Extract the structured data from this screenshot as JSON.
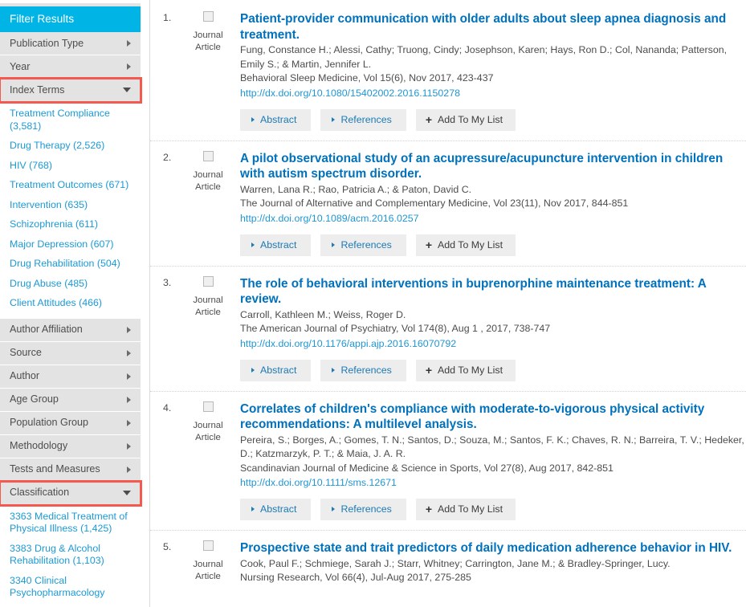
{
  "sidebar": {
    "header": "Filter Results",
    "facets_top": [
      {
        "label": "Publication Type",
        "state": "collapsed"
      },
      {
        "label": "Year",
        "state": "collapsed"
      }
    ],
    "index_terms": {
      "label": "Index Terms",
      "state": "expanded",
      "highlighted": true,
      "links": [
        "Treatment Compliance (3,581)",
        "Drug Therapy (2,526)",
        "HIV (768)",
        "Treatment Outcomes (671)",
        "Intervention (635)",
        "Schizophrenia (611)",
        "Major Depression (607)",
        "Drug Rehabilitation (504)",
        "Drug Abuse (485)",
        "Client Attitudes (466)"
      ]
    },
    "facets_mid": [
      {
        "label": "Author Affiliation",
        "state": "collapsed"
      },
      {
        "label": "Source",
        "state": "collapsed"
      },
      {
        "label": "Author",
        "state": "collapsed"
      },
      {
        "label": "Age Group",
        "state": "collapsed"
      },
      {
        "label": "Population Group",
        "state": "collapsed"
      },
      {
        "label": "Methodology",
        "state": "collapsed"
      },
      {
        "label": "Tests and Measures",
        "state": "collapsed"
      }
    ],
    "classification": {
      "label": "Classification",
      "state": "expanded",
      "highlighted": true,
      "links": [
        "3363 Medical Treatment of Physical Illness (1,425)",
        "3383 Drug & Alcohol Rehabilitation (1,103)",
        "3340 Clinical Psychopharmacology"
      ]
    },
    "colors": {
      "header_bg": "#00b4e6",
      "facet_bg": "#e3e3e3",
      "link": "#1b9ad6",
      "highlight_outline": "#f4584e"
    }
  },
  "actions": {
    "abstract": "Abstract",
    "references": "References",
    "add_to_list": "Add To My List",
    "plus": "+"
  },
  "results": [
    {
      "num": "1.",
      "type_line1": "Journal",
      "type_line2": "Article",
      "title": "Patient-provider communication with older adults about sleep apnea diagnosis and treatment.",
      "authors": "Fung, Constance H.; Alessi, Cathy; Truong, Cindy; Josephson, Karen; Hays, Ron D.; Col, Nananda; Patterson, Emily S.; & Martin, Jennifer L.",
      "source": "Behavioral Sleep Medicine, Vol 15(6), Nov 2017, 423-437",
      "doi": "http://dx.doi.org/10.1080/15402002.2016.1150278"
    },
    {
      "num": "2.",
      "type_line1": "Journal",
      "type_line2": "Article",
      "title": "A pilot observational study of an acupressure/acupuncture intervention in children with autism spectrum disorder.",
      "authors": "Warren, Lana R.; Rao, Patricia A.; & Paton, David C.",
      "source": "The Journal of Alternative and Complementary Medicine, Vol 23(11), Nov 2017, 844-851",
      "doi": "http://dx.doi.org/10.1089/acm.2016.0257"
    },
    {
      "num": "3.",
      "type_line1": "Journal",
      "type_line2": "Article",
      "title": "The role of behavioral interventions in buprenorphine maintenance treatment: A review.",
      "authors": "Carroll, Kathleen M.; Weiss, Roger D.",
      "source": "The American Journal of Psychiatry, Vol 174(8), Aug 1 , 2017, 738-747",
      "doi": "http://dx.doi.org/10.1176/appi.ajp.2016.16070792"
    },
    {
      "num": "4.",
      "type_line1": "Journal",
      "type_line2": "Article",
      "title": "Correlates of children's compliance with moderate-to-vigorous physical activity recommendations: A multilevel analysis.",
      "authors": "Pereira, S.; Borges, A.; Gomes, T. N.; Santos, D.; Souza, M.; Santos, F. K.; Chaves, R. N.; Barreira, T. V.; Hedeker, D.; Katzmarzyk, P. T.; & Maia, J. A. R.",
      "source": "Scandinavian Journal of Medicine & Science in Sports, Vol 27(8), Aug 2017, 842-851",
      "doi": "http://dx.doi.org/10.1111/sms.12671"
    },
    {
      "num": "5.",
      "type_line1": "Journal",
      "type_line2": "Article",
      "title": "Prospective state and trait predictors of daily medication adherence behavior in HIV.",
      "authors": "Cook, Paul F.; Schmiege, Sarah J.; Starr, Whitney; Carrington, Jane M.; & Bradley-Springer, Lucy.",
      "source": "Nursing Research, Vol 66(4), Jul-Aug 2017, 275-285",
      "doi": ""
    }
  ]
}
